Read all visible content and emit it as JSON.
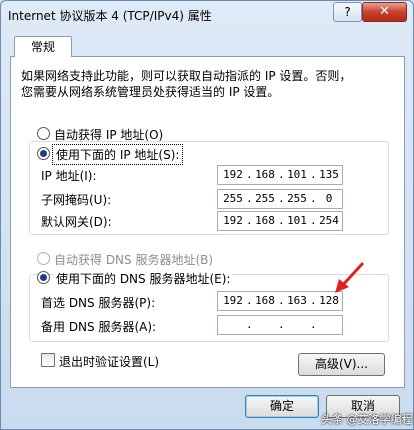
{
  "window": {
    "title": "Internet 协议版本 4 (TCP/IPv4) 属性",
    "help_label": "?",
    "close_label": "✕",
    "close_color": "#c7412d"
  },
  "tabs": [
    {
      "label": "常规",
      "active": true
    }
  ],
  "description": {
    "line1": "如果网络支持此功能，则可以获取自动指派的 IP 设置。否则，",
    "line2": "您需要从网络系统管理员处获得适当的 IP 设置。"
  },
  "ip_section": {
    "auto_label": "自动获得 IP 地址(O)",
    "auto_selected": false,
    "manual_label": "使用下面的 IP 地址(S):",
    "manual_selected": true,
    "fields": [
      {
        "label": "IP 地址(I):",
        "octets": [
          "192",
          "168",
          "101",
          "135"
        ]
      },
      {
        "label": "子网掩码(U):",
        "octets": [
          "255",
          "255",
          "255",
          "0"
        ]
      },
      {
        "label": "默认网关(D):",
        "octets": [
          "192",
          "168",
          "101",
          "254"
        ]
      }
    ]
  },
  "dns_section": {
    "auto_label": "自动获得 DNS 服务器地址(B)",
    "auto_selected": false,
    "auto_disabled": true,
    "manual_label": "使用下面的 DNS 服务器地址(E):",
    "manual_selected": true,
    "fields": [
      {
        "label": "首选 DNS 服务器(P):",
        "octets": [
          "192",
          "168",
          "163",
          "128"
        ]
      },
      {
        "label": "备用 DNS 服务器(A):",
        "octets": [
          "",
          "",
          "",
          ""
        ]
      }
    ]
  },
  "validate_checkbox": {
    "label": "退出时验证设置(L)",
    "checked": false
  },
  "buttons": {
    "advanced": "高级(V)...",
    "ok": "确定",
    "cancel": "取消"
  },
  "watermark": "头条 @艾洛学编程",
  "colors": {
    "accent": "#1b3f8f",
    "annotation_arrow": "#e02020"
  }
}
